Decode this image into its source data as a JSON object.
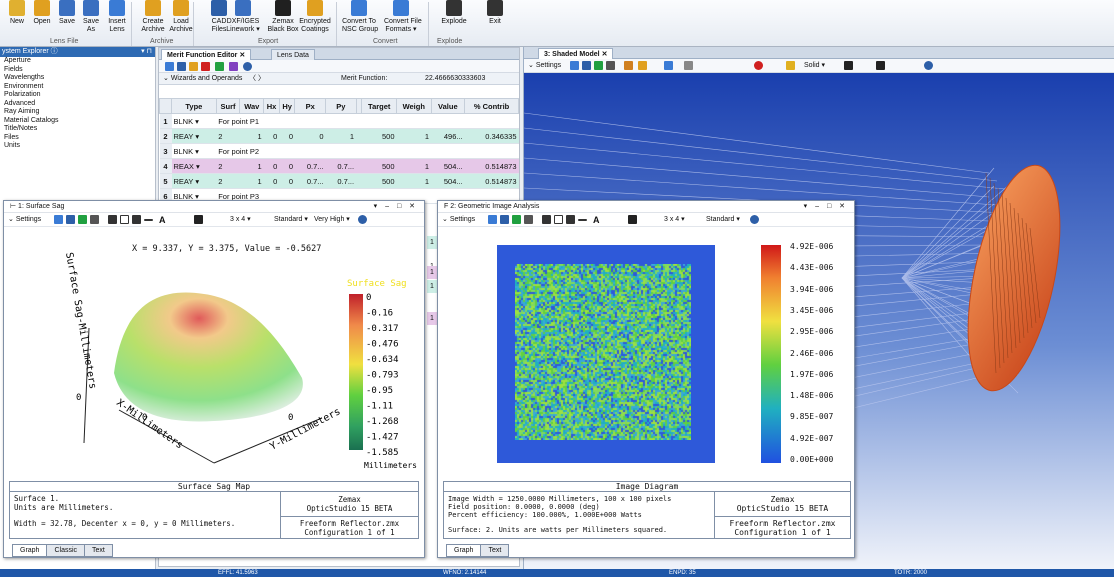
{
  "ribbon": {
    "buttons": [
      "New",
      "Open",
      "Save",
      "Save\nAs",
      "Insert\nLens",
      "Create\nArchive",
      "Load\nArchive",
      "CAD\nFiles",
      "DXF/IGES\nLinework ▾",
      "Zemax\nBlack Box",
      "Encrypted\nCoatings",
      "Convert To\nNSC Group",
      "Convert File\nFormats ▾",
      "Explode",
      "Exit"
    ],
    "groups": [
      "Lens File",
      "Archive",
      "Export",
      "Convert",
      "Explode"
    ]
  },
  "explorer": {
    "title": "ystem Explorer ⓘ",
    "items": [
      "Aperture",
      "Fields",
      "Wavelengths",
      "Environment",
      "Polarization",
      "Advanced",
      "Ray Aiming",
      "Material Catalogs",
      "Title/Notes",
      "Files",
      "Units"
    ]
  },
  "mfe": {
    "tab_active": "Merit Function Editor",
    "tab_other": "Lens Data",
    "wizards": "Wizards and Operands",
    "nav": "〈  〉",
    "merit_label": "Merit Function:",
    "merit_value": "22.4666630333603",
    "headers": [
      "",
      "Type",
      "Surf",
      "Wav",
      "Hx",
      "Hy",
      "Px",
      "Py",
      "",
      "Target",
      "Weigh",
      "Value",
      "% Contrib"
    ],
    "rows": [
      [
        "1",
        "BLNK ▾",
        "For point P1",
        "",
        "",
        "",
        "",
        "",
        "",
        "",
        "",
        "",
        ""
      ],
      [
        "2",
        "REAY ▾",
        "2",
        "1",
        "0",
        "0",
        "0",
        "1",
        "",
        "500",
        "1",
        "496...",
        "0.346335"
      ],
      [
        "3",
        "BLNK ▾",
        "For point P2",
        "",
        "",
        "",
        "",
        "",
        "",
        "",
        "",
        "",
        ""
      ],
      [
        "4",
        "REAX ▾",
        "2",
        "1",
        "0",
        "0",
        "0.7...",
        "0.7...",
        "",
        "500",
        "1",
        "504...",
        "0.514873"
      ],
      [
        "5",
        "REAY ▾",
        "2",
        "1",
        "0",
        "0",
        "0.7...",
        "0.7...",
        "",
        "500",
        "1",
        "504...",
        "0.514873"
      ],
      [
        "6",
        "BLNK ▾",
        "For point P3",
        "",
        "",
        "",
        "",
        "",
        "",
        "",
        "",
        "",
        ""
      ]
    ],
    "under_rows": [
      "1",
      "1",
      "1",
      "1",
      "1"
    ]
  },
  "shaded": {
    "tab": "3: Shaded Model",
    "settings": "Settings",
    "solid": "Solid ▾"
  },
  "sag": {
    "title": "1: Surface Sag",
    "settings": "Settings",
    "layout": "3 x 4 ▾",
    "standard": "Standard ▾",
    "quality": "Very High ▾",
    "readout": "X = 9.337, Y = 3.375, Value = -0.5627",
    "legend_title": "Surface Sag",
    "legend_values": [
      "0",
      "-0.16",
      "-0.317",
      "-0.476",
      "-0.634",
      "-0.793",
      "-0.95",
      "-1.11",
      "-1.268",
      "-1.427",
      "-1.585"
    ],
    "legend_units": "Millimeters",
    "zlabel": "Surface Sag-Millimeters",
    "xlabel": "X-Millimeters",
    "ylabel": "Y-Millimeters",
    "tick_0": "0",
    "caption": "Surface Sag Map",
    "info": [
      "Surface 1.",
      "Units are Millimeters.",
      "",
      "Width = 32.78, Decenter x = 0, y = 0 Millimeters."
    ],
    "brand": [
      "Zemax",
      "OpticStudio 15  BETA"
    ],
    "file": [
      "Freeform Reflector.zmx",
      "Configuration 1 of 1"
    ],
    "tabs": [
      "Graph",
      "Classic",
      "Text"
    ]
  },
  "gia": {
    "title": "2: Geometric Image Analysis",
    "settings": "Settings",
    "layout": "3 x 4 ▾",
    "standard": "Standard ▾",
    "legend_values": [
      "4.92E-006",
      "4.43E-006",
      "3.94E-006",
      "3.45E-006",
      "2.95E-006",
      "2.46E-006",
      "1.97E-006",
      "1.48E-006",
      "9.85E-007",
      "4.92E-007",
      "0.00E+000"
    ],
    "caption": "Image Diagram",
    "info": [
      "Image Width = 1250.0000 Millimeters, 100 x 100 pixels",
      "Field position:    0.0000, 0.0000 (deg)",
      "Percent efficiency: 100.000%, 1.000E+000 Watts",
      "",
      "Surface: 2. Units are watts per Millimeters squared."
    ],
    "brand": [
      "Zemax",
      "OpticStudio 15  BETA"
    ],
    "file": [
      "Freeform Reflector.zmx",
      "Configuration 1 of 1"
    ],
    "tabs": [
      "Graph",
      "Text"
    ]
  },
  "status": {
    "effl": "EFFL: 41.5963",
    "wfno": "WFNO: 2.14144",
    "enpd": "ENPD: 35",
    "totr": "TOTR: 2000"
  },
  "colors": {
    "accent": "#1f57a8",
    "cone": "#e8642a",
    "image_bg": "#2e59d9"
  }
}
